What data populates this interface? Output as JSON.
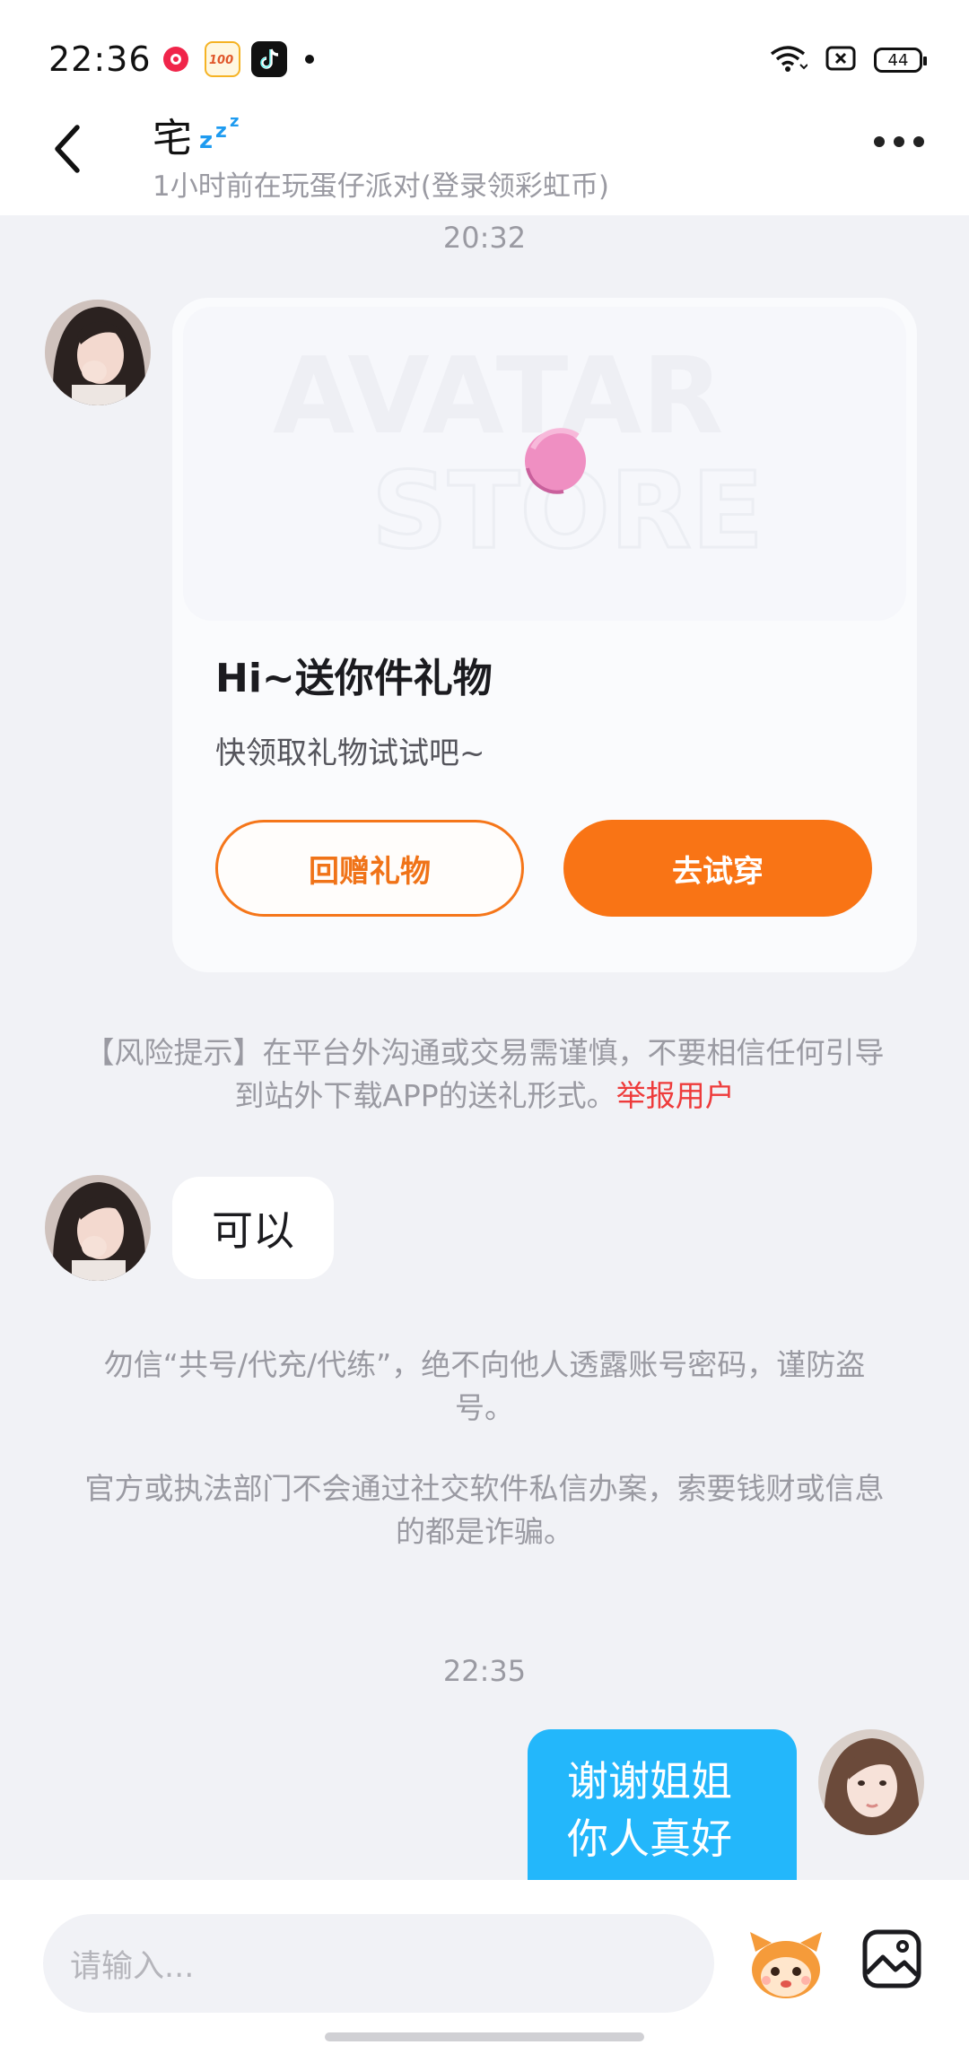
{
  "status_bar": {
    "time": "22:36",
    "battery": "44",
    "left_icons": [
      "xiaohongshu-icon",
      "100-icon",
      "tiktok-icon",
      "notification-dot"
    ],
    "right_icons": [
      "wifi-icon",
      "sim-icon",
      "battery-icon"
    ]
  },
  "header": {
    "name": "宅",
    "name_emoji": "💤",
    "status": "1小时前在玩蛋仔派对(登录领彩虹币)"
  },
  "messages": {
    "timestamp_1": "20:32",
    "gift_card": {
      "banner_text_1": "AVATAR",
      "banner_text_2": "STORE",
      "title": "Hi~送你件礼物",
      "subtitle": "快领取礼物试试吧~",
      "button_return": "回赠礼物",
      "button_try": "去试穿"
    },
    "risk_notice": "【风险提示】在平台外沟通或交易需谨慎，不要相信任何引导到站外下载APP的送礼形式。",
    "report_link": "举报用户",
    "reply_text": "可以",
    "warning_1": "勿信“共号/代充/代练”，绝不向他人透露账号密码，谨防盗号。",
    "warning_2": "官方或执法部门不会通过社交软件私信办案，索要钱财或信息的都是诈骗。",
    "timestamp_2": "22:35",
    "my_message_line1": "谢谢姐姐",
    "my_message_line2": "你人真好"
  },
  "input": {
    "placeholder": "请输入..."
  },
  "colors": {
    "accent_orange": "#f97415",
    "bubble_blue": "#23b7fb",
    "report_red": "#ee3b3b",
    "background": "#f1f2f6"
  }
}
